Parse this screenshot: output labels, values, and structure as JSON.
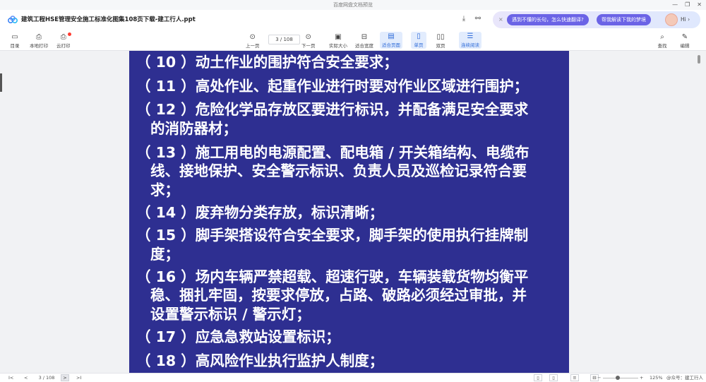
{
  "window": {
    "title": "百度网盘文档预览",
    "controls": [
      "—",
      "❐",
      "✕"
    ]
  },
  "header": {
    "file_name": "建筑工程HSE管理安全施工标准化图集108页下载-建工行人.ppt",
    "download_icon": "⤓",
    "share_icon": "⚯"
  },
  "assistant": {
    "close": "×",
    "chip1": "遇到不懂的长句，怎么快速翻译?",
    "chip2": "帮我解读下我的梦境",
    "greeting": "Hi ›"
  },
  "toolbar": {
    "catalog": "目录",
    "local_print": "本地打印",
    "cloud_print": "云打印",
    "prev": "上一页",
    "page_input": "3  / 108",
    "next": "下一页",
    "actual_size": "实际大小",
    "fit_width": "适合宽度",
    "fit_page": "适合页面",
    "single_page": "单页",
    "double_page": "双页",
    "continuous": "连续阅读",
    "search": "查找",
    "edit": "编辑"
  },
  "slide": {
    "lines": [
      "（ 10 ）动土作业的围护符合安全要求；",
      "（ 11 ）高处作业、起重作业进行时要对作业区域进行围护；",
      "（ 12 ）危险化学品存放区要进行标识，并配备满足安全要求",
      "的消防器材；",
      "（ 13 ）施工用电的电源配置、配电箱 / 开关箱结构、电缆布",
      "线、接地保护、安全警示标识、负责人员及巡检记录符合要",
      "求；",
      "（ 14 ）废弃物分类存放，标识清晰；",
      "（ 15 ）脚手架搭设符合安全要求，脚手架的使用执行挂牌制",
      "度；",
      "（ 16 ）场内车辆严禁超载、超速行驶，车辆装载货物均衡平",
      "稳、捆扎牢固，按要求停放，占路、破路必须经过审批，并",
      "设置警示标识 / 警示灯；",
      "（ 17 ）应急急救站设置标识；",
      "（ 18 ）高风险作业执行监护人制度；"
    ]
  },
  "statusbar": {
    "first": "I<",
    "prev": "<",
    "page": "3  / 108",
    "next": ">",
    "last": ">I",
    "zoom_minus": "−",
    "zoom_plus": "+",
    "zoom": "125%",
    "watermark": "@众号：建工行人"
  }
}
